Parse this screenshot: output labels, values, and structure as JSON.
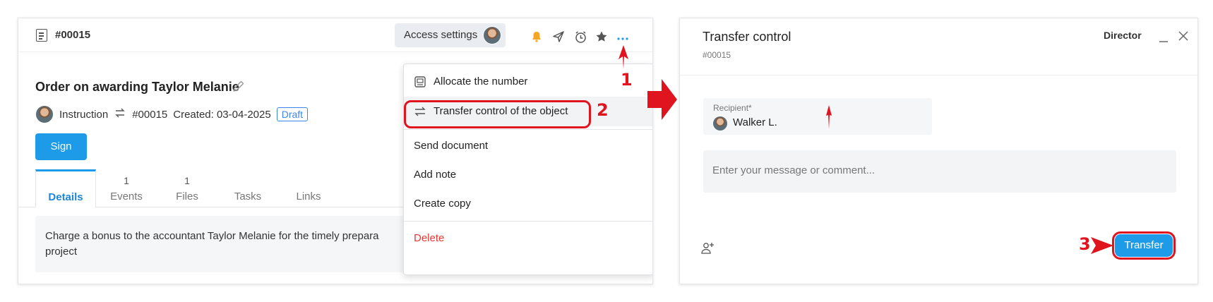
{
  "left_panel": {
    "doc_id": "#00015",
    "access_settings_label": "Access settings",
    "title": "Order on awarding Taylor Melanie",
    "meta": {
      "type": "Instruction",
      "number": "#00015",
      "created": "Created: 03-04-2025",
      "status": "Draft"
    },
    "sign_label": "Sign",
    "tabs": [
      {
        "count": "",
        "label": "Details"
      },
      {
        "count": "1",
        "label": "Events"
      },
      {
        "count": "1",
        "label": "Files"
      },
      {
        "count": "",
        "label": "Tasks"
      },
      {
        "count": "",
        "label": "Links"
      }
    ],
    "description_line1": "Charge a bonus to the accountant Taylor Melanie for the timely prepara",
    "description_line2": "project",
    "menu": {
      "allocate": "Allocate the number",
      "transfer": "Transfer control of the object",
      "send": "Send document",
      "note": "Add note",
      "copy": "Create copy",
      "delete": "Delete"
    }
  },
  "steps": {
    "one": "1",
    "two": "2",
    "three": "3"
  },
  "right_panel": {
    "title": "Transfer control",
    "subtitle": "#00015",
    "role": "Director",
    "recipient_label": "Recipient*",
    "recipient_value": "Walker L.",
    "message_placeholder": "Enter your message or comment...",
    "transfer_label": "Transfer"
  },
  "colors": {
    "accent": "#1e9be8",
    "annotation_red": "#e0141e",
    "bell": "#f5a623"
  }
}
